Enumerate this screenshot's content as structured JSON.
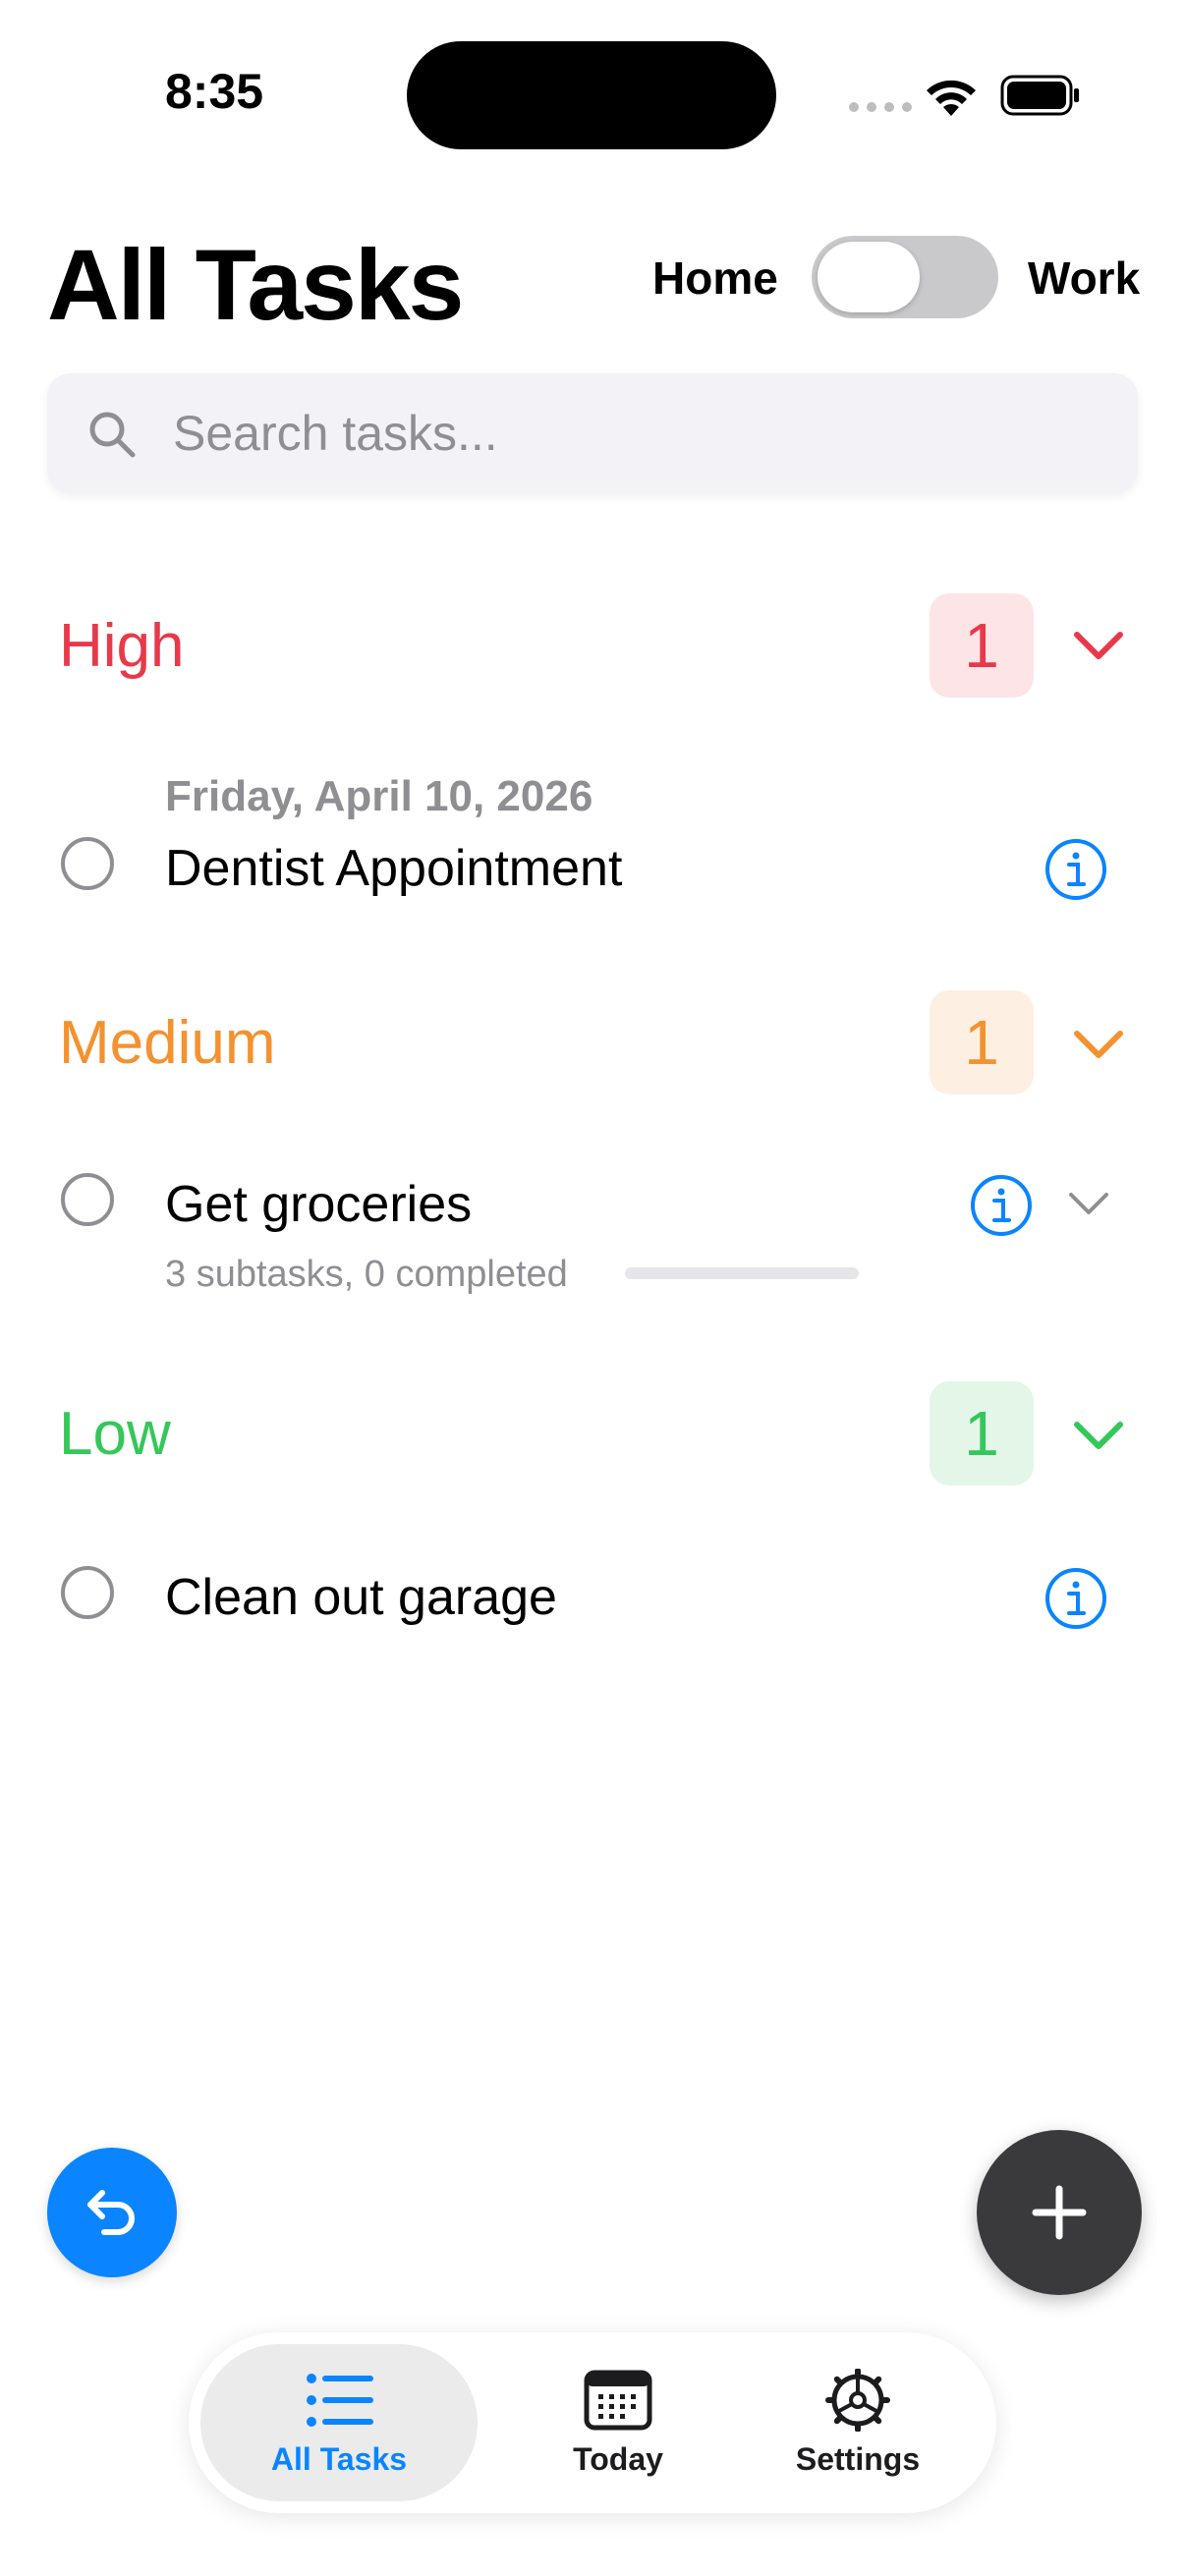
{
  "status_bar": {
    "time": "8:35"
  },
  "header": {
    "title": "All Tasks",
    "toggle_left_label": "Home",
    "toggle_right_label": "Work"
  },
  "search": {
    "placeholder": "Search tasks..."
  },
  "colors": {
    "high": "#e8394a",
    "medium": "#f3922f",
    "low": "#34c759",
    "accent": "#0a84ff"
  },
  "sections": [
    {
      "title": "High",
      "count": "1",
      "tasks": [
        {
          "date": "Friday, April 10, 2026",
          "title": "Dentist Appointment"
        }
      ]
    },
    {
      "title": "Medium",
      "count": "1",
      "tasks": [
        {
          "title": "Get groceries",
          "subtasks": "3 subtasks, 0 completed",
          "progress": 0
        }
      ]
    },
    {
      "title": "Low",
      "count": "1",
      "tasks": [
        {
          "title": "Clean out garage"
        }
      ]
    }
  ],
  "tabs": [
    {
      "label": "All Tasks",
      "icon": "list-icon",
      "selected": true
    },
    {
      "label": "Today",
      "icon": "calendar-icon",
      "selected": false
    },
    {
      "label": "Settings",
      "icon": "gear-icon",
      "selected": false
    }
  ]
}
